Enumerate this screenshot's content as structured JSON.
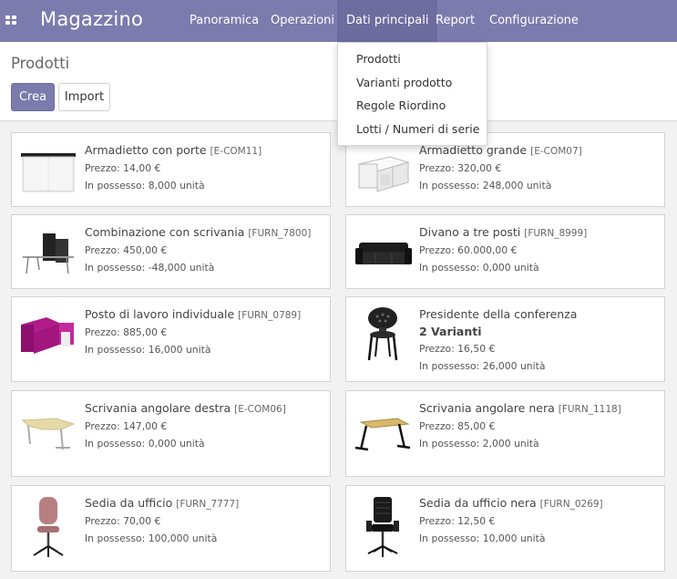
{
  "app": {
    "title": "Magazzino"
  },
  "nav": {
    "items": [
      {
        "label": "Panoramica"
      },
      {
        "label": "Operazioni"
      },
      {
        "label": "Dati principali"
      },
      {
        "label": "Report"
      },
      {
        "label": "Configurazione"
      }
    ],
    "active": "Dati principali"
  },
  "dropdown": {
    "items": [
      "Prodotti",
      "Varianti prodotto",
      "Regole Riordino",
      "Lotti / Numeri di serie"
    ]
  },
  "control_panel": {
    "breadcrumb": "Prodotti",
    "create_label": "Crea",
    "import_label": "Import"
  },
  "products": [
    {
      "name": "Armadietto con porte",
      "ref": "[E-COM11]",
      "price": "Prezzo: 14,00 €",
      "stock": "In possesso: 8,000 unità",
      "variants": "",
      "icon": "white-cabinet-icon"
    },
    {
      "name": "Armadietto grande",
      "ref": "[E-COM07]",
      "price": "Prezzo: 320,00 €",
      "stock": "In possesso: 248,000 unità",
      "variants": "",
      "icon": "large-shelf-cabinet-icon"
    },
    {
      "name": "Combinazione con scrivania",
      "ref": "[FURN_7800]",
      "price": "Prezzo: 450,00 €",
      "stock": "In possesso: -48,000 unità",
      "variants": "",
      "icon": "desk-combination-icon"
    },
    {
      "name": "Divano a tre posti",
      "ref": "[FURN_8999]",
      "price": "Prezzo: 60.000,00 €",
      "stock": "In possesso: 0,000 unità",
      "variants": "",
      "icon": "sofa-icon"
    },
    {
      "name": "Posto di lavoro individuale",
      "ref": "[FURN_0789]",
      "price": "Prezzo: 885,00 €",
      "stock": "In possesso: 16,000 unità",
      "variants": "",
      "icon": "workstation-pod-icon"
    },
    {
      "name": "Presidente della conferenza",
      "ref": "",
      "price": "Prezzo: 16,50 €",
      "stock": "In possesso: 26,000 unità",
      "variants": "2 Varianti",
      "icon": "conference-chair-icon"
    },
    {
      "name": "Scrivania angolare destra",
      "ref": "[E-COM06]",
      "price": "Prezzo: 147,00 €",
      "stock": "In possesso: 0,000 unità",
      "variants": "",
      "icon": "corner-desk-icon"
    },
    {
      "name": "Scrivania angolare nera",
      "ref": "[FURN_1118]",
      "price": "Prezzo: 85,00 €",
      "stock": "In possesso: 2,000 unità",
      "variants": "",
      "icon": "black-desk-icon"
    },
    {
      "name": "Sedia da ufficio",
      "ref": "[FURN_7777]",
      "price": "Prezzo: 70,00 €",
      "stock": "In possesso: 100,000 unità",
      "variants": "",
      "icon": "pink-office-chair-icon"
    },
    {
      "name": "Sedia da ufficio nera",
      "ref": "[FURN_0269]",
      "price": "Prezzo: 12,50 €",
      "stock": "In possesso: 10,000 unità",
      "variants": "",
      "icon": "black-office-chair-icon"
    }
  ],
  "colors": {
    "brand": "#7c7bad",
    "brand_dark": "#6d6c9e",
    "background": "#f2f2f2"
  }
}
